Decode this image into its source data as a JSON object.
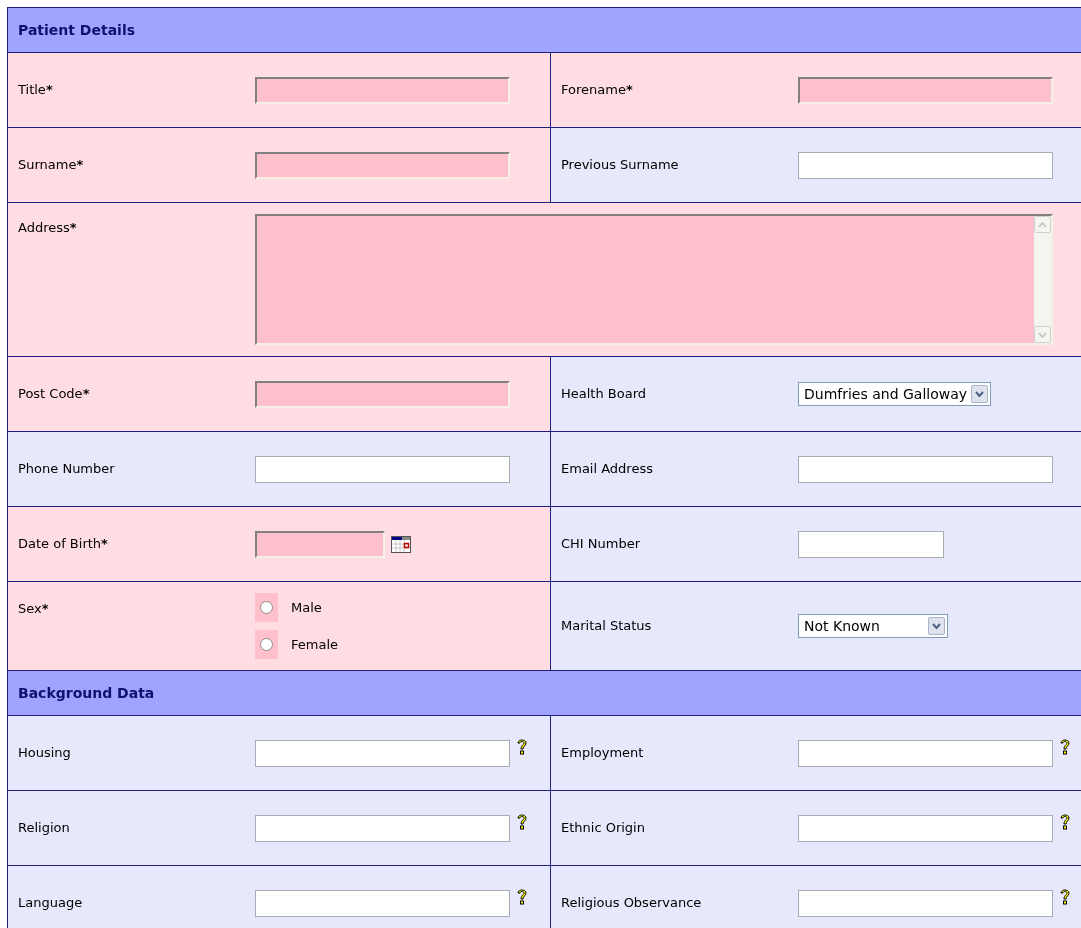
{
  "sections": [
    {
      "title": "Patient Details",
      "rows": [
        {
          "cells": [
            {
              "label": "Title",
              "asterisk": "*",
              "required": true,
              "kind": "text",
              "help": false
            },
            {
              "label": "Forename",
              "asterisk": "*",
              "required": true,
              "kind": "text",
              "help": false
            }
          ]
        },
        {
          "cells": [
            {
              "label": "Surname",
              "asterisk": "*",
              "required": true,
              "kind": "text",
              "help": false
            },
            {
              "label": "Previous Surname",
              "required": false,
              "kind": "text",
              "help": false
            }
          ]
        },
        {
          "cells": [
            {
              "label": "Address",
              "asterisk": "*",
              "required": true,
              "kind": "textarea",
              "help": false
            }
          ]
        },
        {
          "cells": [
            {
              "label": "Post Code",
              "asterisk": "*",
              "required": true,
              "kind": "text",
              "help": false
            },
            {
              "label": "Health Board",
              "required": false,
              "kind": "select",
              "value": "Dumfries and Galloway",
              "help": false
            }
          ]
        },
        {
          "cells": [
            {
              "label": "Phone Number",
              "required": false,
              "kind": "text",
              "help": false
            },
            {
              "label": "Email Address",
              "required": false,
              "kind": "text",
              "help": false
            }
          ]
        },
        {
          "cells": [
            {
              "label": "Date of Birth",
              "asterisk": "*",
              "required": true,
              "kind": "date",
              "help": false
            },
            {
              "label": "CHI Number",
              "required": false,
              "kind": "short_text",
              "help": false
            }
          ]
        },
        {
          "cells": [
            {
              "label": "Sex",
              "asterisk": "*",
              "required": true,
              "kind": "radio",
              "help": false,
              "options": [
                {
                  "label": "Male",
                  "selected": false
                },
                {
                  "label": "Female",
                  "selected": false
                }
              ]
            },
            {
              "label": "Marital Status",
              "required": false,
              "kind": "select",
              "value": "Not Known",
              "help": false
            }
          ]
        }
      ]
    },
    {
      "title": "Background Data",
      "rows": [
        {
          "cells": [
            {
              "label": "Housing",
              "required": false,
              "kind": "text",
              "help": true
            },
            {
              "label": "Employment",
              "required": false,
              "kind": "text",
              "help": true
            }
          ]
        },
        {
          "cells": [
            {
              "label": "Religion",
              "required": false,
              "kind": "text",
              "help": true
            },
            {
              "label": "Ethnic Origin",
              "required": false,
              "kind": "text",
              "help": true
            }
          ]
        },
        {
          "cells": [
            {
              "label": "Language",
              "required": false,
              "kind": "text",
              "help": true
            },
            {
              "label": "Religious Observance",
              "required": false,
              "kind": "text",
              "help": true
            }
          ]
        }
      ]
    }
  ]
}
